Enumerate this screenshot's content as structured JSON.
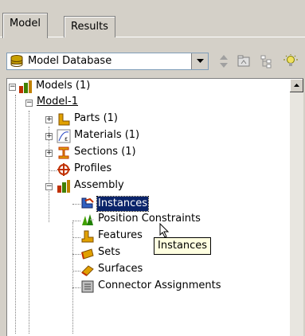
{
  "tabs": [
    {
      "label": "Model",
      "active": true
    },
    {
      "label": "Results",
      "active": false
    }
  ],
  "toolbar": {
    "database_select": "Model Database",
    "icons": [
      "updown-arrows-icon",
      "folder-icon",
      "tree-expand-icon",
      "lightbulb-icon"
    ]
  },
  "tree": {
    "models": "Models (1)",
    "model1": "Model-1",
    "parts": "Parts (1)",
    "materials": "Materials (1)",
    "sections": "Sections (1)",
    "profiles": "Profiles",
    "assembly": "Assembly",
    "instances": "Instances",
    "position_constraints": "Position Constraints",
    "features": "Features",
    "sets": "Sets",
    "surfaces": "Surfaces",
    "connector_assignments": "Connector Assignments"
  },
  "tooltip": "Instances",
  "colors": {
    "window_bg": "#d4d0c8",
    "selection": "#0a246a",
    "tooltip_bg": "#ffffe1"
  }
}
